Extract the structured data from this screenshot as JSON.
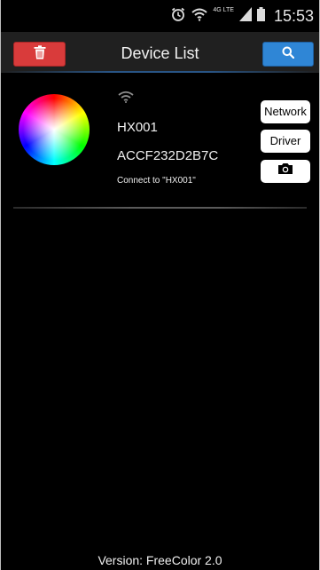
{
  "status_bar": {
    "lte_label": "4G LTE",
    "time": "15:53",
    "icons": [
      "alarm-icon",
      "wifi-icon",
      "signal-icon",
      "battery-icon"
    ]
  },
  "header": {
    "title": "Device List",
    "delete_icon": "trash-icon",
    "search_icon": "search-icon",
    "delete_color": "#d93b3b",
    "search_color": "#2f86d6"
  },
  "device": {
    "name": "HX001",
    "mac": "ACCF232D2B7C",
    "connect_text": "Connect to \"HX001\"",
    "network_label": "Network",
    "driver_label": "Driver",
    "camera_icon": "camera-icon"
  },
  "footer": {
    "version": "Version: FreeColor 2.0"
  }
}
